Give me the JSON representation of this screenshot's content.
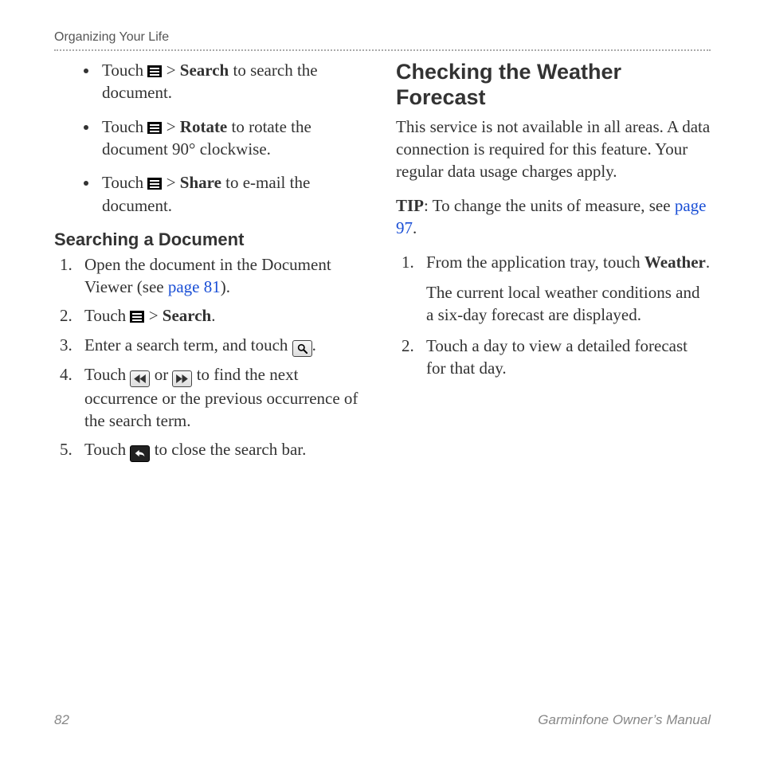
{
  "running_head": "Organizing Your Life",
  "left": {
    "bullets": [
      {
        "pre": "Touch ",
        "action": "Search",
        "post": " to search the document."
      },
      {
        "pre": "Touch ",
        "action": "Rotate",
        "post": " to rotate the document 90° clockwise."
      },
      {
        "pre": "Touch ",
        "action": "Share",
        "post": " to e-mail the document."
      }
    ],
    "h3": "Searching a Document",
    "steps": {
      "s1a": "Open the document in the Document Viewer (see ",
      "s1link": "page 81",
      "s1b": ").",
      "s2a": "Touch ",
      "s2b": " > ",
      "s2bold": "Search",
      "s2c": ".",
      "s3a": "Enter a search term, and touch ",
      "s3b": ".",
      "s4a": "Touch ",
      "s4mid": " or ",
      "s4b": " to find the next occurrence or the previous occurrence of the search term.",
      "s5a": "Touch ",
      "s5b": " to close the search bar."
    }
  },
  "right": {
    "h2": "Checking the Weather Forecast",
    "p1": "This service is not available in all areas. A data connection is required for this feature. Your regular data usage charges apply.",
    "tip_label": "TIP",
    "tip_a": ": To change the units of measure, see ",
    "tip_link": "page 97",
    "tip_b": ".",
    "steps": {
      "s1a": "From the application tray, touch ",
      "s1bold": "Weather",
      "s1b": ".",
      "s1note": "The current local weather conditions and a six-day forecast are displayed.",
      "s2": "Touch a day to view a detailed forecast for that day."
    }
  },
  "footer": {
    "page": "82",
    "title": "Garminfone Owner’s Manual"
  },
  "gt": ">"
}
